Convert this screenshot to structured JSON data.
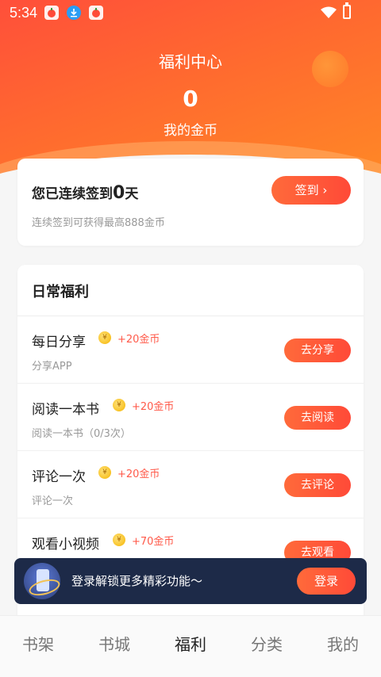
{
  "status_bar": {
    "time": "5:34",
    "app_icons": [
      "tomato-app-icon",
      "download-icon",
      "tomato-app-icon"
    ],
    "wifi_icon": "wifi-icon",
    "battery_icon": "battery-charging-icon"
  },
  "header": {
    "title": "福利中心",
    "coins": "0",
    "coins_label": "我的金币"
  },
  "checkin": {
    "prefix": "您已连续签到",
    "days": "0",
    "suffix": "天",
    "subtitle": "连续签到可获得最高888金币",
    "button_label": "签到 ›"
  },
  "daily": {
    "header": "日常福利",
    "tasks": [
      {
        "title": "每日分享",
        "reward": "+20金币",
        "desc": "分享APP",
        "button": "去分享"
      },
      {
        "title": "阅读一本书",
        "reward": "+20金币",
        "desc": "阅读一本书（0/3次）",
        "button": "去阅读"
      },
      {
        "title": "评论一次",
        "reward": "+20金币",
        "desc": "评论一次",
        "button": "去评论"
      },
      {
        "title": "观看小视频",
        "reward": "+70金币",
        "desc": "",
        "button": "去观看"
      }
    ]
  },
  "login_banner": {
    "text": "登录解锁更多精彩功能～",
    "button": "登录"
  },
  "bottom_nav": {
    "items": [
      "书架",
      "书城",
      "福利",
      "分类",
      "我的"
    ],
    "active": "福利"
  },
  "colors": {
    "accent": "#ff5a3a",
    "reward_text": "#ff5a4a",
    "banner_bg": "#1d2a48"
  }
}
